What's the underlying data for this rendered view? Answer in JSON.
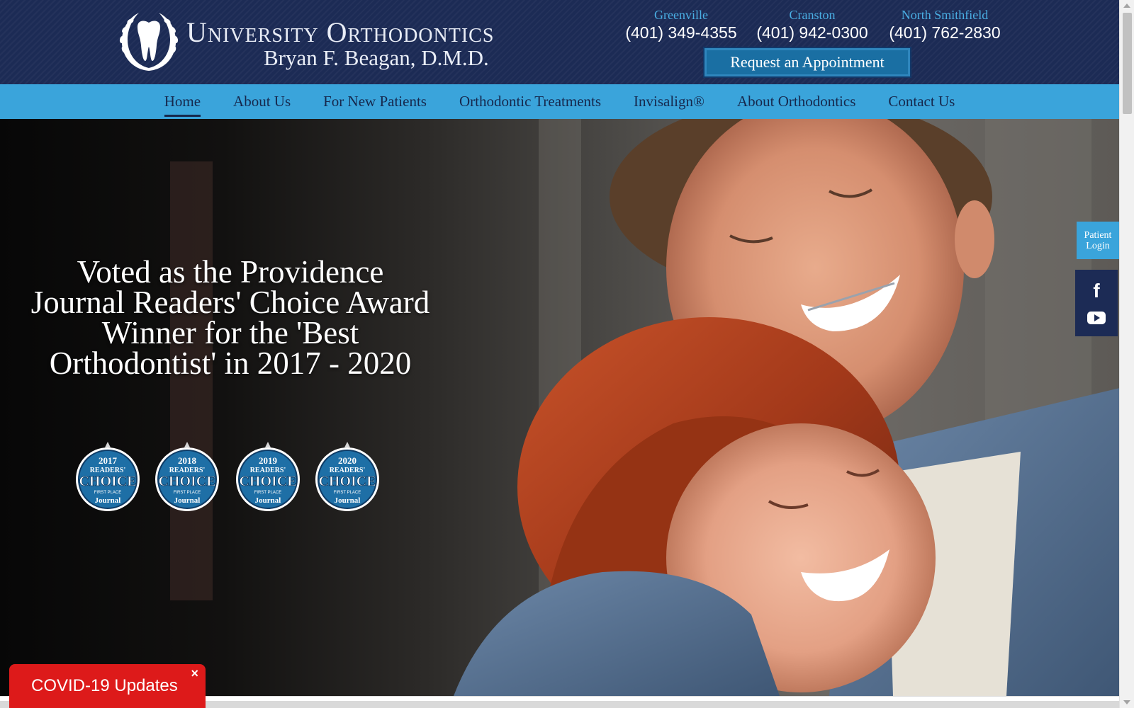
{
  "header": {
    "brand_name": "University Orthodontics",
    "doctor": "Bryan F. Beagan, D.M.D.",
    "locations": [
      {
        "name": "Greenville",
        "phone": "(401) 349-4355"
      },
      {
        "name": "Cranston",
        "phone": "(401) 942-0300"
      },
      {
        "name": "North Smithfield",
        "phone": "(401) 762-2830"
      }
    ],
    "appointment_label": "Request an Appointment"
  },
  "nav": {
    "items": [
      {
        "label": "Home",
        "active": true
      },
      {
        "label": "About Us"
      },
      {
        "label": "For New Patients"
      },
      {
        "label": "Orthodontic Treatments"
      },
      {
        "label": "Invisalign®"
      },
      {
        "label": "About Orthodontics"
      },
      {
        "label": "Contact Us"
      }
    ]
  },
  "hero": {
    "headline": "Voted as the Providence Journal Readers' Choice Award Winner for the 'Best Orthodontist' in 2017 - 2020",
    "badges": [
      {
        "year": "2017",
        "line1": "READERS'",
        "line2": "CHOICE",
        "line3": "FIRST PLACE",
        "line4": "Journal"
      },
      {
        "year": "2018",
        "line1": "READERS'",
        "line2": "CHOICE",
        "line3": "FIRST PLACE",
        "line4": "Journal"
      },
      {
        "year": "2019",
        "line1": "READERS'",
        "line2": "CHOICE",
        "line3": "FIRST PLACE",
        "line4": "Journal"
      },
      {
        "year": "2020",
        "line1": "READERS'",
        "line2": "CHOICE",
        "line3": "FIRST PLACE",
        "line4": "Journal"
      }
    ]
  },
  "side": {
    "patient_login_line1": "Patient",
    "patient_login_line2": "Login",
    "social_icons": [
      "facebook-icon",
      "youtube-icon"
    ],
    "facebook_glyph": "f"
  },
  "covid": {
    "label": "COVID-19 Updates",
    "close": "×"
  },
  "colors": {
    "header_bg": "#1c2b55",
    "nav_bg": "#3aa4db",
    "accent_blue": "#4aaee3",
    "covid_red": "#dd1a1a"
  }
}
